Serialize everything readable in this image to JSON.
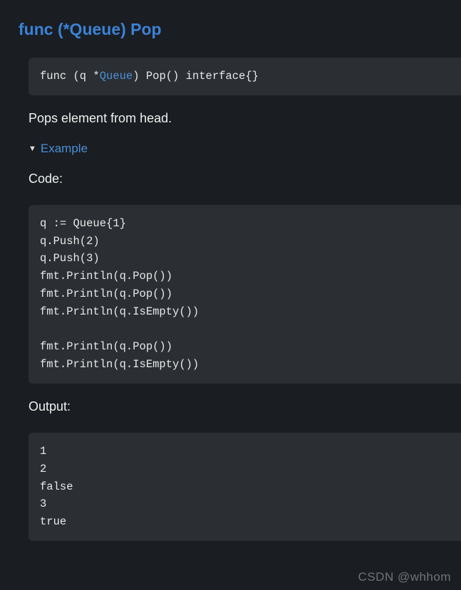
{
  "heading": "func (*Queue) Pop",
  "signature": {
    "prefix": "func (q *",
    "type": "Queue",
    "suffix": ") Pop() interface{}"
  },
  "description": "Pops element from head.",
  "exampleLabel": "Example",
  "codeLabel": "Code:",
  "codeBody": "q := Queue{1}\nq.Push(2)\nq.Push(3)\nfmt.Println(q.Pop())\nfmt.Println(q.Pop())\nfmt.Println(q.IsEmpty())\n\nfmt.Println(q.Pop())\nfmt.Println(q.IsEmpty())",
  "outputLabel": "Output:",
  "outputBody": "1\n2\nfalse\n3\ntrue",
  "watermark": "CSDN @whhom"
}
